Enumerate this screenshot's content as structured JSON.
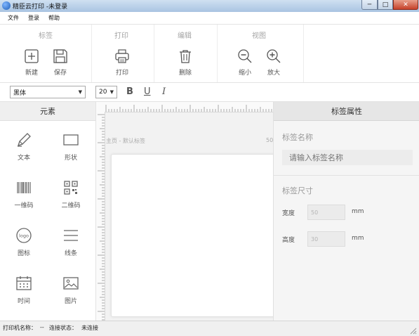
{
  "window": {
    "title": "精臣云打印 -未登录",
    "controls": {
      "minimize": "─",
      "maximize": "□",
      "close": "✕"
    }
  },
  "menu": [
    "文件",
    "登录",
    "帮助"
  ],
  "ribbon": {
    "groups": [
      {
        "title": "标签",
        "buttons": [
          {
            "label": "新建",
            "icon": "add-square-icon"
          },
          {
            "label": "保存",
            "icon": "save-disk-icon"
          }
        ]
      },
      {
        "title": "打印",
        "buttons": [
          {
            "label": "打印",
            "icon": "printer-icon"
          }
        ]
      },
      {
        "title": "编辑",
        "buttons": [
          {
            "label": "删除",
            "icon": "trash-icon"
          }
        ]
      },
      {
        "title": "视图",
        "buttons": [
          {
            "label": "缩小",
            "icon": "zoom-out-icon"
          },
          {
            "label": "放大",
            "icon": "zoom-in-icon"
          }
        ]
      }
    ]
  },
  "format": {
    "font_family": "黑体",
    "font_size": "20",
    "bold": "B",
    "underline": "U",
    "italic": "I"
  },
  "elements_panel": {
    "title": "元素",
    "items": [
      {
        "label": "文本",
        "icon": "pencil-icon"
      },
      {
        "label": "形状",
        "icon": "rectangle-icon"
      },
      {
        "label": "一维码",
        "icon": "barcode-icon"
      },
      {
        "label": "二维码",
        "icon": "qrcode-icon"
      },
      {
        "label": "图标",
        "icon": "logo-icon",
        "icon_text": "logo"
      },
      {
        "label": "线条",
        "icon": "lines-icon"
      },
      {
        "label": "时间",
        "icon": "calendar-icon"
      },
      {
        "label": "图片",
        "icon": "image-icon"
      }
    ]
  },
  "canvas": {
    "page_label": "主页 - 默认标签",
    "page_size": "50"
  },
  "properties": {
    "title": "标签属性",
    "label_name_title": "标签名称",
    "label_name_placeholder": "请输入标签名称",
    "size_title": "标签尺寸",
    "width_label": "宽度",
    "width_value": "50",
    "height_label": "高度",
    "height_value": "30",
    "unit": "mm"
  },
  "status": {
    "printer_label": "打印机名称：",
    "printer_value": "--",
    "conn_label": "连接状态：",
    "conn_value": "未连接"
  }
}
